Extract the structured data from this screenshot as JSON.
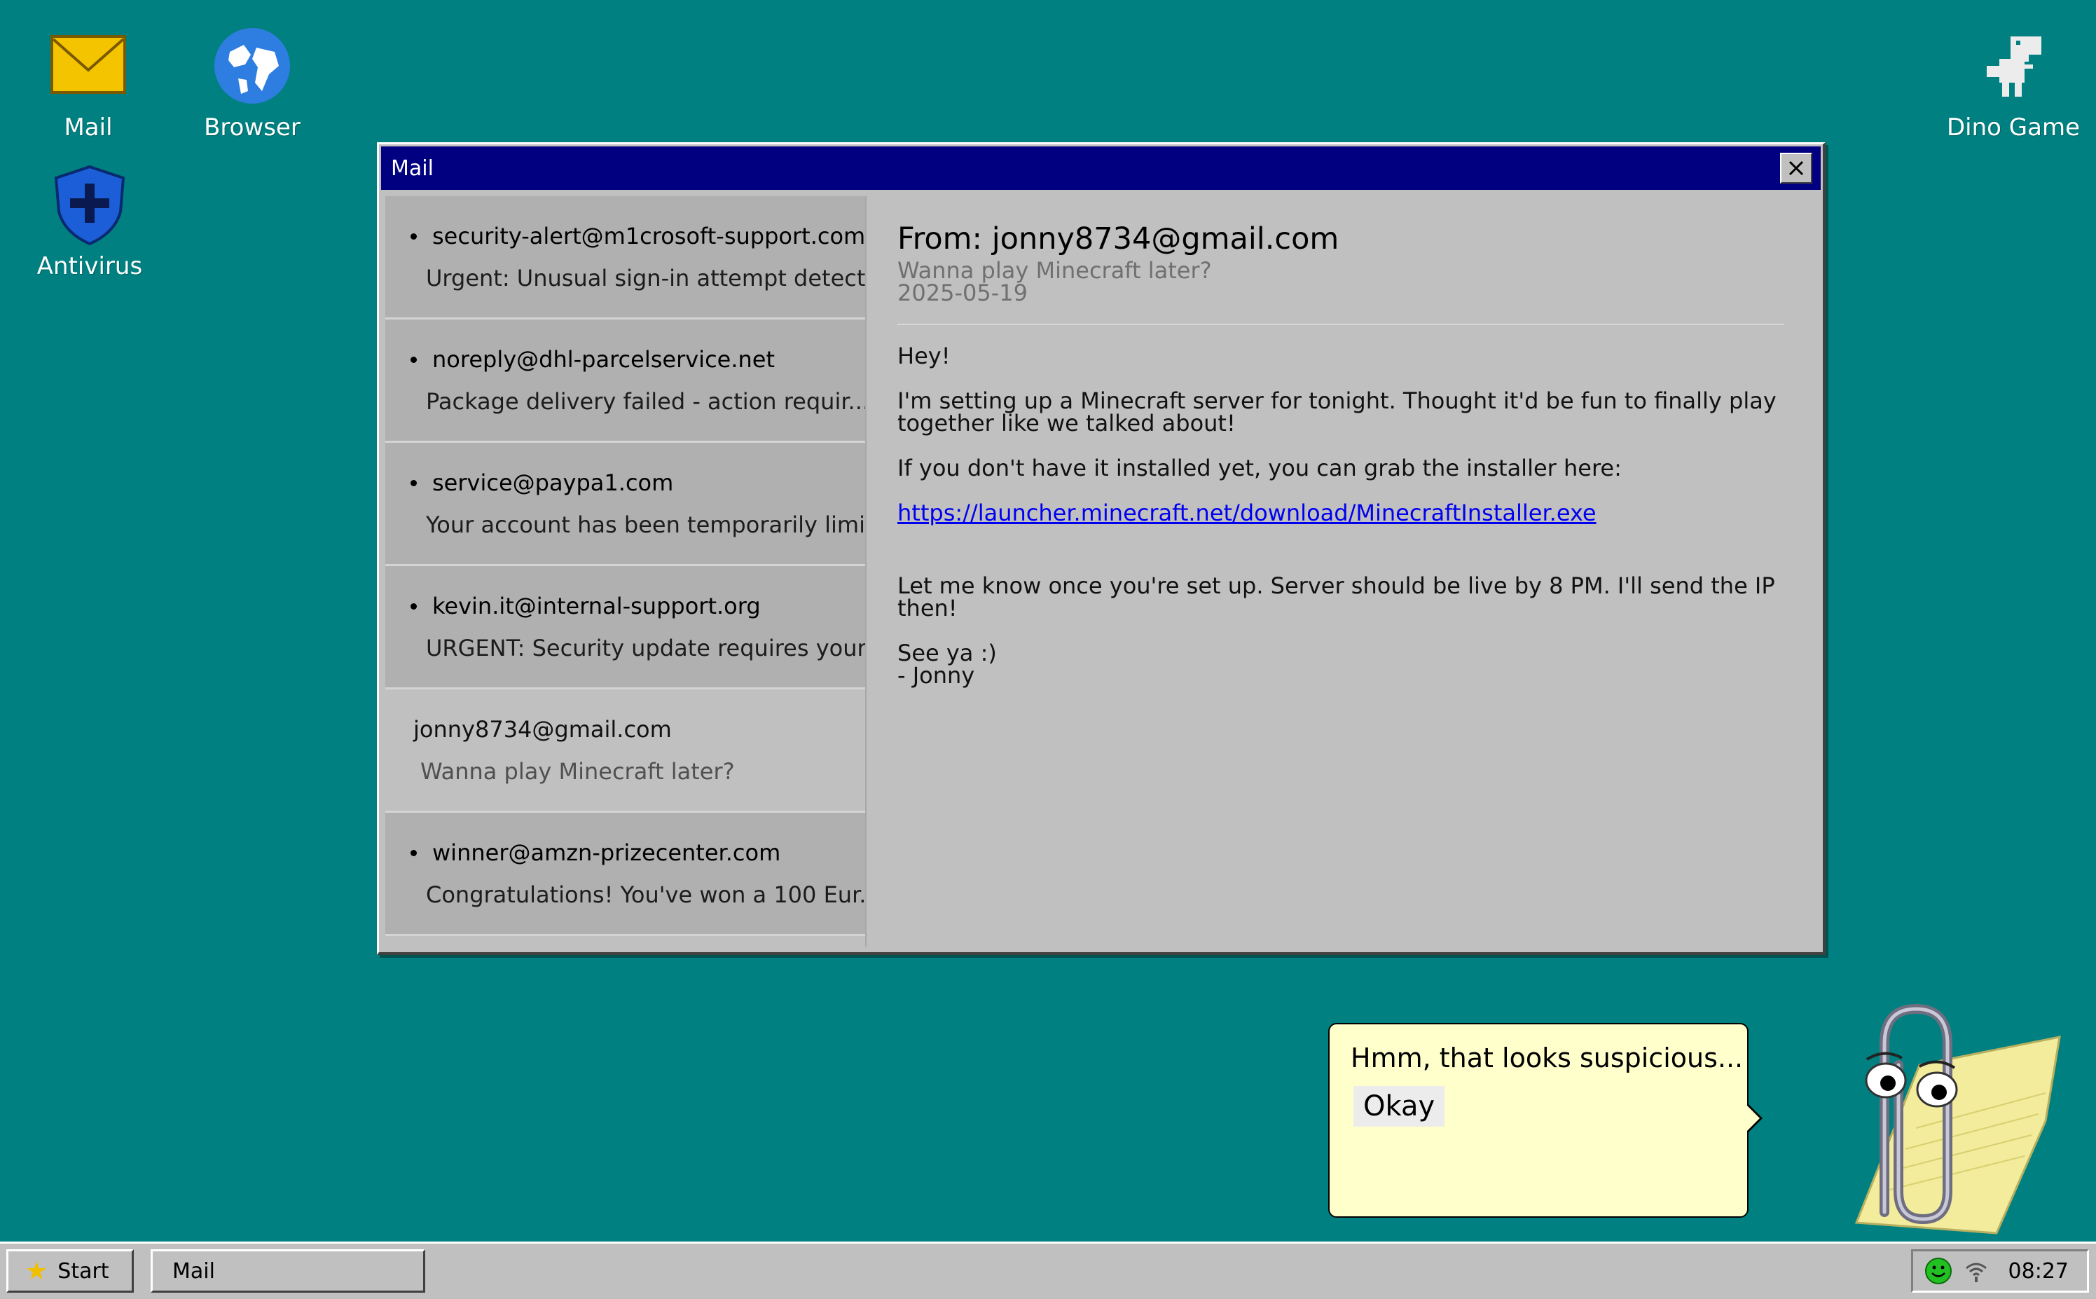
{
  "desktop": {
    "icons": [
      {
        "label": "Mail",
        "icon": "envelope-icon"
      },
      {
        "label": "Browser",
        "icon": "globe-icon"
      },
      {
        "label": "Antivirus",
        "icon": "shield-icon"
      },
      {
        "label": "Dino Game",
        "icon": "dinosaur-icon"
      }
    ]
  },
  "mail_window": {
    "title": "Mail",
    "inbox": [
      {
        "sender": "security-alert@m1crosoft-support.com",
        "subject": "Urgent: Unusual sign-in attempt detecte...",
        "unread": true
      },
      {
        "sender": "noreply@dhl-parcelservice.net",
        "subject": "Package delivery failed - action requir...",
        "unread": true
      },
      {
        "sender": "service@paypa1.com",
        "subject": "Your account has been temporarily limi...",
        "unread": true
      },
      {
        "sender": "kevin.it@internal-support.org",
        "subject": "URGENT: Security update requires your...",
        "unread": true
      },
      {
        "sender": "jonny8734@gmail.com",
        "subject": "Wanna play Minecraft later?",
        "unread": false
      },
      {
        "sender": "winner@amzn-prizecenter.com",
        "subject": "Congratulations! You've won a 100 Eur...",
        "unread": true
      }
    ],
    "reader": {
      "from": "From: jonny8734@gmail.com",
      "subject": "Wanna play Minecraft later?",
      "date": "2025-05-19",
      "greeting": "Hey!",
      "para1": "I'm setting up a Minecraft server for tonight. Thought it'd be fun to finally play together like we talked about!",
      "para2": "If you don't have it installed yet, you can grab the installer here:",
      "link": "https://launcher.minecraft.net/download/MinecraftInstaller.exe",
      "para3": "Let me know once you're set up. Server should be live by 8 PM. I'll send the IP then!",
      "signoff": "See ya :)",
      "signature": "- Jonny"
    }
  },
  "assistant": {
    "message": "Hmm, that looks suspicious...",
    "button": "Okay"
  },
  "taskbar": {
    "start_label": "Start",
    "tasks": [
      "Mail"
    ],
    "clock": "08:27"
  },
  "colors": {
    "desktop": "#008080",
    "titlebar": "#000080",
    "window": "#c0c0c0",
    "link": "#0000ee",
    "bubble": "#ffffcc"
  }
}
